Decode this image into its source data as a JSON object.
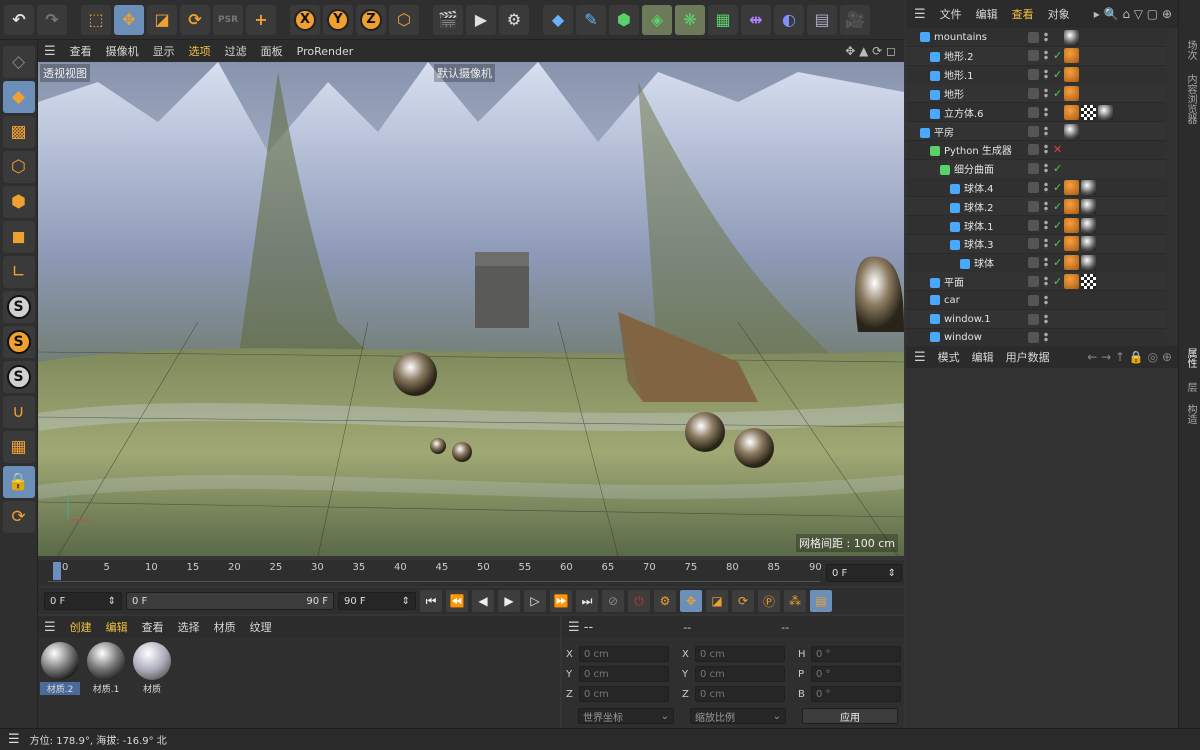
{
  "toolbar": {
    "axis_x": "X",
    "axis_y": "Y",
    "axis_z": "Z"
  },
  "viewport": {
    "menu": [
      "查看",
      "摄像机",
      "显示",
      "选项",
      "过滤",
      "面板",
      "ProRender"
    ],
    "active_menu": "选项",
    "view_label": "透视视图",
    "camera_label": "默认摄像机",
    "grid_spacing": "网格间距 : 100 cm"
  },
  "timeline": {
    "ticks": [
      "0",
      "5",
      "10",
      "15",
      "20",
      "25",
      "30",
      "35",
      "40",
      "45",
      "50",
      "55",
      "60",
      "65",
      "70",
      "75",
      "80",
      "85",
      "90"
    ],
    "current_frame": "0 F",
    "start_field": "0 F",
    "range_start": "0 F",
    "range_end": "90 F",
    "end_field": "90 F"
  },
  "materials": {
    "menu": [
      "创建",
      "编辑",
      "查看",
      "选择",
      "材质",
      "纹理"
    ],
    "items": [
      "材质.2",
      "材质.1",
      "材质"
    ]
  },
  "coords": {
    "header": [
      "--",
      "--",
      "--"
    ],
    "rows": [
      {
        "a": "X",
        "av": "0 cm",
        "b": "X",
        "bv": "0 cm",
        "c": "H",
        "cv": "0 °"
      },
      {
        "a": "Y",
        "av": "0 cm",
        "b": "Y",
        "bv": "0 cm",
        "c": "P",
        "cv": "0 °"
      },
      {
        "a": "Z",
        "av": "0 cm",
        "b": "Z",
        "bv": "0 cm",
        "c": "B",
        "cv": "0 °"
      }
    ],
    "world_dropdown": "世界坐标",
    "scale_dropdown": "缩放比例",
    "apply": "应用"
  },
  "objects": {
    "menu": [
      "文件",
      "编辑",
      "查看",
      "对象"
    ],
    "active_menu": "查看",
    "rows": [
      {
        "name": "mountains",
        "indent": 0,
        "icon": "#4aa8ff",
        "check": false,
        "tags": [
          "sphere"
        ]
      },
      {
        "name": "地形.2",
        "indent": 1,
        "icon": "#4aa8ff",
        "check": true,
        "tags": [
          "orange"
        ]
      },
      {
        "name": "地形.1",
        "indent": 1,
        "icon": "#4aa8ff",
        "check": true,
        "tags": [
          "orange"
        ]
      },
      {
        "name": "地形",
        "indent": 1,
        "icon": "#4aa8ff",
        "check": true,
        "tags": [
          "orange"
        ]
      },
      {
        "name": "立方体.6",
        "indent": 1,
        "icon": "#4aa8ff",
        "check": false,
        "tags": [
          "orange",
          "check",
          "sphere"
        ]
      },
      {
        "name": "平房",
        "indent": 0,
        "icon": "#4aa8ff",
        "check": false,
        "tags": [
          "sphere"
        ]
      },
      {
        "name": "Python 生成器",
        "indent": 1,
        "icon": "#5ad06a",
        "check": false,
        "x": true,
        "tags": []
      },
      {
        "name": "细分曲面",
        "indent": 2,
        "icon": "#5ad06a",
        "check": true,
        "tags": []
      },
      {
        "name": "球体.4",
        "indent": 3,
        "icon": "#4aa8ff",
        "check": true,
        "tags": [
          "orange",
          "sphere"
        ]
      },
      {
        "name": "球体.2",
        "indent": 3,
        "icon": "#4aa8ff",
        "check": true,
        "tags": [
          "orange",
          "sphere"
        ]
      },
      {
        "name": "球体.1",
        "indent": 3,
        "icon": "#4aa8ff",
        "check": true,
        "tags": [
          "orange",
          "sphere"
        ]
      },
      {
        "name": "球体.3",
        "indent": 3,
        "icon": "#4aa8ff",
        "check": true,
        "tags": [
          "orange",
          "sphere"
        ]
      },
      {
        "name": "球体",
        "indent": 4,
        "icon": "#4aa8ff",
        "check": true,
        "tags": [
          "orange",
          "sphere"
        ]
      },
      {
        "name": "平面",
        "indent": 1,
        "icon": "#4aa8ff",
        "check": true,
        "tags": [
          "orange",
          "check"
        ]
      },
      {
        "name": "car",
        "indent": 1,
        "icon": "#4aa8ff",
        "check": false,
        "tags": []
      },
      {
        "name": "window.1",
        "indent": 1,
        "icon": "#4aa8ff",
        "check": false,
        "tags": []
      },
      {
        "name": "window",
        "indent": 1,
        "icon": "#4aa8ff",
        "check": false,
        "tags": []
      }
    ]
  },
  "attributes": {
    "menu": [
      "模式",
      "编辑",
      "用户数据"
    ]
  },
  "right_tabs": [
    "场次",
    "内容浏览器",
    "属性",
    "层",
    "构造"
  ],
  "status": "方位: 178.9°, 海拔: -16.9° 北"
}
